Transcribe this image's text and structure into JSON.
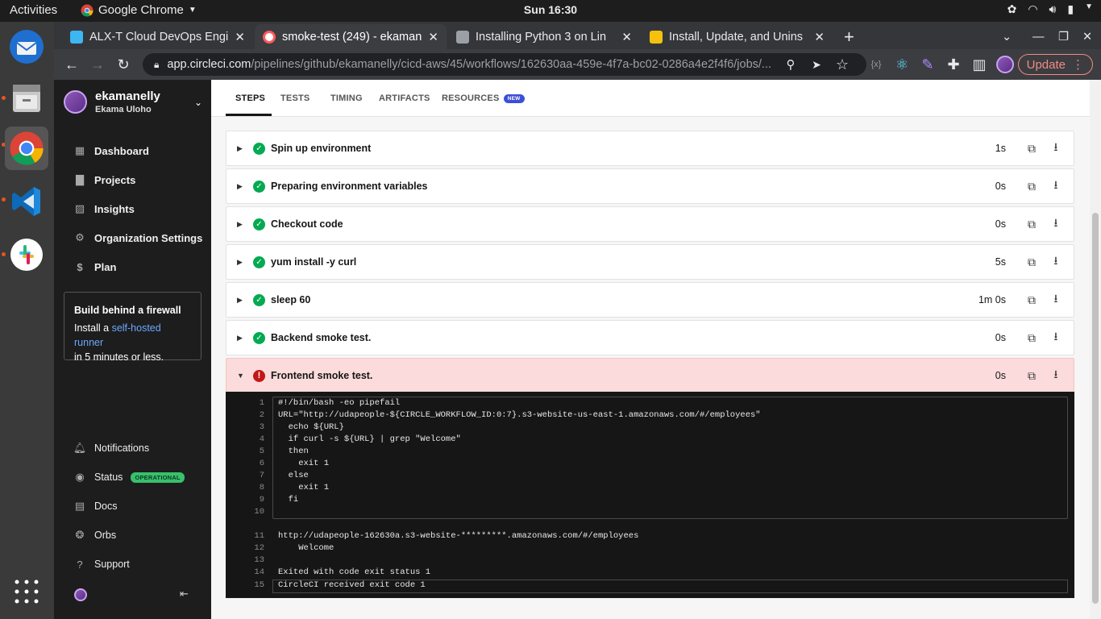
{
  "os": {
    "activities": "Activities",
    "app_name": "Google Chrome",
    "clock": "Sun 16:30"
  },
  "browser": {
    "tabs": [
      {
        "title": "ALX-T Cloud DevOps Engi",
        "icon": "udacity-icon",
        "color": "#3db6f2"
      },
      {
        "title": "smoke-test (249) - ekaman",
        "icon": "circleci-icon",
        "color": "#ff5a5a"
      },
      {
        "title": "Installing Python 3 on Lin",
        "icon": "book-icon",
        "color": "#9aa0a6"
      },
      {
        "title": "Install, Update, and Unins",
        "icon": "aws-cube-icon",
        "color": "#f4c20d"
      }
    ],
    "url_host": "app.circleci.com",
    "url_path": "/pipelines/github/ekamanelly/cicd-aws/45/workflows/162630aa-459e-4f7a-bc02-0286a4e2f4f6/jobs/...",
    "update_label": "Update"
  },
  "sidebar": {
    "user_name": "ekamanelly",
    "user_sub": "Ekama Uloho",
    "nav": [
      {
        "label": "Dashboard",
        "icon": "dashboard-icon"
      },
      {
        "label": "Projects",
        "icon": "projects-icon"
      },
      {
        "label": "Insights",
        "icon": "insights-icon"
      },
      {
        "label": "Organization Settings",
        "icon": "gear-icon"
      },
      {
        "label": "Plan",
        "icon": "dollar-icon"
      }
    ],
    "firewall": {
      "title": "Build behind a firewall",
      "text_before": "Install a ",
      "link": "self-hosted runner",
      "text_after": "in 5 minutes or less."
    },
    "bottom": [
      {
        "label": "Notifications",
        "icon": "bell-icon"
      },
      {
        "label": "Status",
        "icon": "status-icon",
        "badge": "OPERATIONAL"
      },
      {
        "label": "Docs",
        "icon": "docs-icon"
      },
      {
        "label": "Orbs",
        "icon": "orbs-icon"
      },
      {
        "label": "Support",
        "icon": "help-icon"
      }
    ]
  },
  "job_tabs": {
    "steps": "STEPS",
    "tests": "TESTS",
    "timing": "TIMING",
    "artifacts": "ARTIFACTS",
    "resources": "RESOURCES",
    "new_badge": "NEW"
  },
  "steps": [
    {
      "name": "Spin up environment",
      "duration": "1s",
      "status": "success"
    },
    {
      "name": "Preparing environment variables",
      "duration": "0s",
      "status": "success"
    },
    {
      "name": "Checkout code",
      "duration": "0s",
      "status": "success"
    },
    {
      "name": "yum install -y curl",
      "duration": "5s",
      "status": "success"
    },
    {
      "name": "sleep 60",
      "duration": "1m 0s",
      "status": "success"
    },
    {
      "name": "Backend smoke test.",
      "duration": "0s",
      "status": "success"
    },
    {
      "name": "Frontend smoke test.",
      "duration": "0s",
      "status": "failed"
    }
  ],
  "terminal": {
    "command": [
      {
        "n": "1",
        "text": "#!/bin/bash -eo pipefail"
      },
      {
        "n": "2",
        "text": "URL=\"http://udapeople-${CIRCLE_WORKFLOW_ID:0:7}.s3-website-us-east-1.amazonaws.com/#/employees\""
      },
      {
        "n": "3",
        "text": "  echo ${URL}"
      },
      {
        "n": "4",
        "text": "  if curl -s ${URL} | grep \"Welcome\""
      },
      {
        "n": "5",
        "text": "  then"
      },
      {
        "n": "6",
        "text": "    exit 1"
      },
      {
        "n": "7",
        "text": "  else"
      },
      {
        "n": "8",
        "text": "    exit 1"
      },
      {
        "n": "9",
        "text": "  fi"
      },
      {
        "n": "10",
        "text": ""
      }
    ],
    "output": [
      {
        "n": "11",
        "text": "http://udapeople-162630a.s3-website-*********.amazonaws.com/#/employees"
      },
      {
        "n": "12",
        "text": "    Welcome"
      },
      {
        "n": "13",
        "text": ""
      },
      {
        "n": "14",
        "text": "Exited with code exit status 1"
      },
      {
        "n": "15",
        "text": "CircleCI received exit code 1"
      }
    ]
  }
}
